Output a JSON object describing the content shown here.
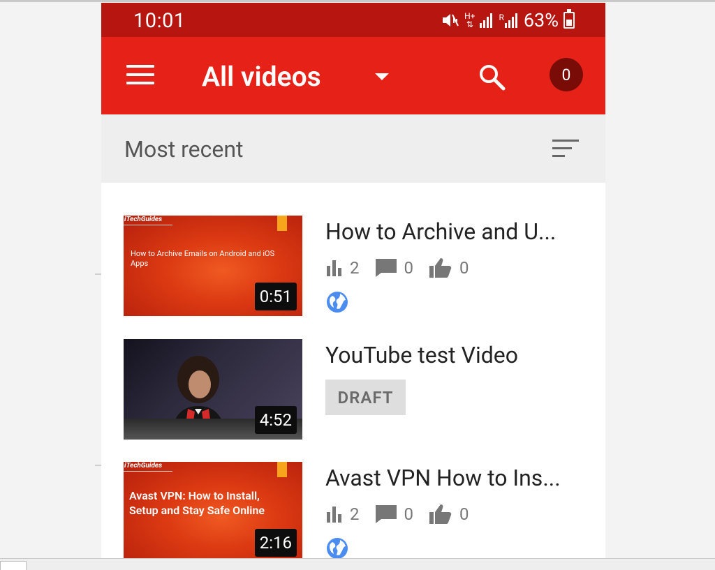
{
  "status_bar": {
    "time": "10:01",
    "battery_percent": "63%",
    "network_label": "H+",
    "roaming_label": "R"
  },
  "app_bar": {
    "title": "All videos",
    "notification_count": "0"
  },
  "filter": {
    "label": "Most recent"
  },
  "videos": [
    {
      "title": "How to Archive and U...",
      "duration": "0:51",
      "thumbnail_brand": "iTechGuides",
      "thumbnail_text": "How to Archive Emails on Android and iOS Apps",
      "views": "2",
      "comments": "0",
      "likes": "0",
      "visibility_icon": "globe-icon"
    },
    {
      "title": "YouTube test Video",
      "duration": "4:52",
      "badge": "DRAFT"
    },
    {
      "title": "Avast VPN How to Ins...",
      "duration": "2:16",
      "thumbnail_brand": "iTechGuides",
      "thumbnail_text": "Avast VPN: How to Install, Setup and Stay Safe Online",
      "views": "2",
      "comments": "0",
      "likes": "0",
      "visibility_icon": "globe-icon"
    }
  ],
  "colors": {
    "status_bar": "#b71510",
    "app_bar": "#e62117",
    "badge": "#7a0c08",
    "globe": "#4a8cf0"
  }
}
